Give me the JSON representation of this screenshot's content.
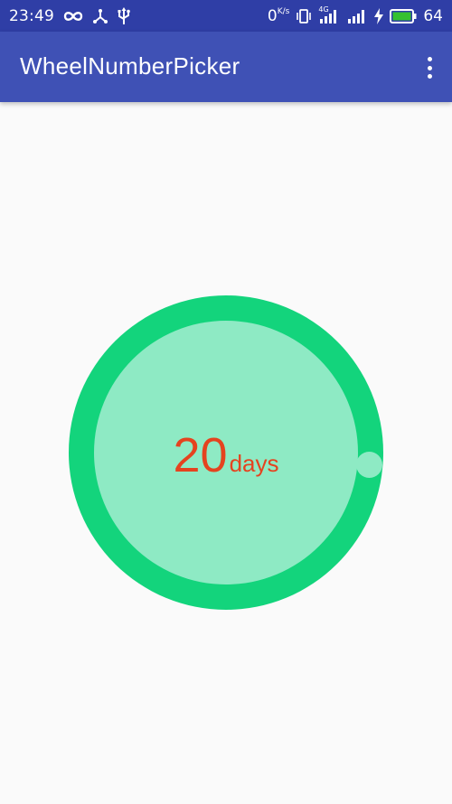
{
  "status_bar": {
    "time": "23:49",
    "data_rate": "0",
    "data_rate_unit": "K/s",
    "network_label": "4G",
    "battery_level": "64",
    "icons": [
      "infinity-icon",
      "usb-share-icon",
      "usb-icon",
      "vibrate-icon",
      "signal-4g-icon",
      "signal-icon",
      "charging-icon",
      "battery-icon"
    ],
    "battery_color": "#35c12f"
  },
  "app_bar": {
    "title": "WheelNumberPicker",
    "background": "#3f51b5",
    "menu_icon": "more-vert-icon"
  },
  "wheel_picker": {
    "value": "20",
    "unit": "days",
    "ring_color": "#13d47c",
    "fill_color": "#8eeac4",
    "text_color": "#e5431f"
  }
}
